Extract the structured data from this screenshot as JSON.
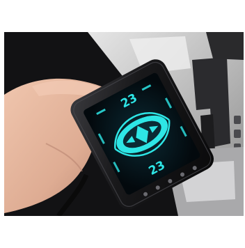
{
  "photo": {
    "subject": "handheld-remote-lcd",
    "colors": {
      "page_bg": "#ffffff",
      "dark_bg": "#101012",
      "console_silver": "#c9c9c9",
      "lcd_bg": "#06121a",
      "lcd_glow": "#2ee6e6",
      "skin": "#e3b49c",
      "device_body": "#1a1a1c"
    }
  },
  "display": {
    "left_temperature": "23",
    "right_temperature": "23"
  }
}
